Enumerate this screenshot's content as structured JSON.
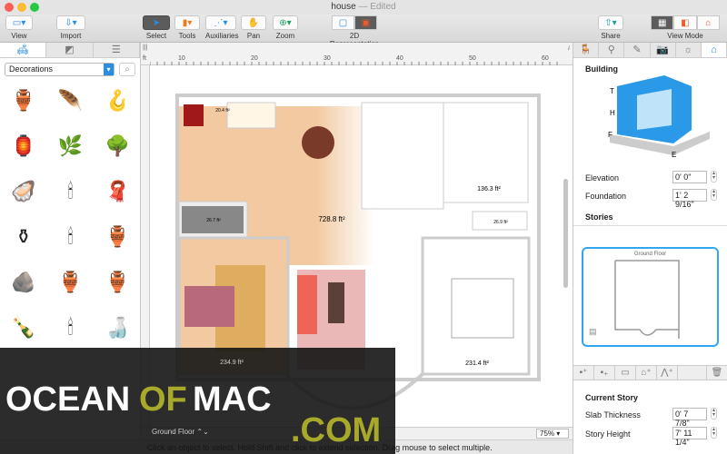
{
  "window": {
    "title": "house",
    "edited": "— Edited"
  },
  "toolbar": {
    "view": "View",
    "import": "Import",
    "select": "Select",
    "tools": "Tools",
    "auxiliaries": "Auxiliaries",
    "pan": "Pan",
    "zoom": "Zoom",
    "representation": "2D Representation",
    "share": "Share",
    "view_mode": "View Mode"
  },
  "library": {
    "category": "Decorations",
    "items": [
      "🏺",
      "🪶",
      "🪝",
      "🏮",
      "🌿",
      "🌳",
      "🦪",
      "🕯",
      "🧣",
      "⚱",
      "🕯",
      "🏺",
      "🪨",
      "🏺",
      "🏺",
      "🍾",
      "🕯",
      "🍶"
    ]
  },
  "ruler": {
    "unit": "ft",
    "ticks": [
      "10",
      "20",
      "30",
      "40",
      "50",
      "60"
    ]
  },
  "plan": {
    "areas": [
      "20.4 ft²",
      "728.8 ft²",
      "136.3 ft²",
      "26.7 ft²",
      "26.9 ft²",
      "234.9 ft²",
      "231.4 ft²"
    ]
  },
  "canvas_footer": {
    "floor": "Ground Floor",
    "zoom": "75%"
  },
  "status": "Click an object to select. Hold Shift and click to extend selection. Drag mouse to select multiple.",
  "inspector": {
    "building_title": "Building",
    "diagram_labels": [
      "T",
      "H",
      "F",
      "E"
    ],
    "elevation_label": "Elevation",
    "elevation": "0' 0\"",
    "foundation_label": "Foundation",
    "foundation": "1' 2 9/16\"",
    "stories_title": "Stories",
    "story_name": "Ground Floor",
    "current_story_title": "Current Story",
    "slab_label": "Slab Thickness",
    "slab": "0' 7 7/8\"",
    "height_label": "Story Height",
    "height": "7' 11 1/4\""
  },
  "watermark": {
    "text1": "OCEAN",
    "text2": "OF",
    "text3": "MAC",
    "text4": ".COM"
  },
  "colors": {
    "accent": "#2a8de0",
    "floor_wood": "#f2c9a0",
    "watermark_olive": "#a8a82a"
  }
}
